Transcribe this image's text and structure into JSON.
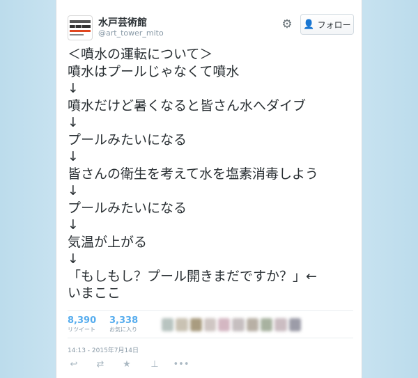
{
  "profile": {
    "display_name": "水戸芸術館",
    "screen_name": "@art_tower_mito",
    "avatar_icon": "art-tower-mito-logo"
  },
  "follow_button": {
    "label": "フォロー",
    "icon": "follow-user-icon"
  },
  "settings_icon": "gear-icon",
  "tweet": {
    "lines": [
      "＜噴水の運転について＞",
      "噴水はプールじゃなくて噴水",
      "↓",
      "噴水だけど暑くなると皆さん水へダイブ",
      "↓",
      "プールみたいになる",
      "↓",
      "皆さんの衛生を考えて水を塩素消毒しよう",
      "↓",
      "プールみたいになる",
      "↓",
      "気温が上がる",
      "↓",
      "「もしもし？プール開きまだですか？」←",
      "いまここ"
    ]
  },
  "stats": {
    "retweets": {
      "count": "8,390",
      "label": "リツイート"
    },
    "favorites": {
      "count": "3,338",
      "label": "お気に入り"
    },
    "avatar_colors": [
      "#b8c4c0",
      "#c9c2b3",
      "#a99c80",
      "#cfc6c3",
      "#d4b7c2",
      "#c6bfc0",
      "#b8b0a5",
      "#a8b2a0",
      "#cbbdc2",
      "#9c9ca8"
    ]
  },
  "timestamp": "14:13 - 2015年7月14日",
  "actions": {
    "reply_icon": "reply-icon",
    "retweet_icon": "retweet-icon",
    "favorite_icon": "star-icon",
    "follow_icon": "follow-icon",
    "more_icon": "more-icon"
  },
  "colors": {
    "background": "#c0deed",
    "text": "#292f33",
    "muted": "#8899a6",
    "link": "#55acee"
  }
}
